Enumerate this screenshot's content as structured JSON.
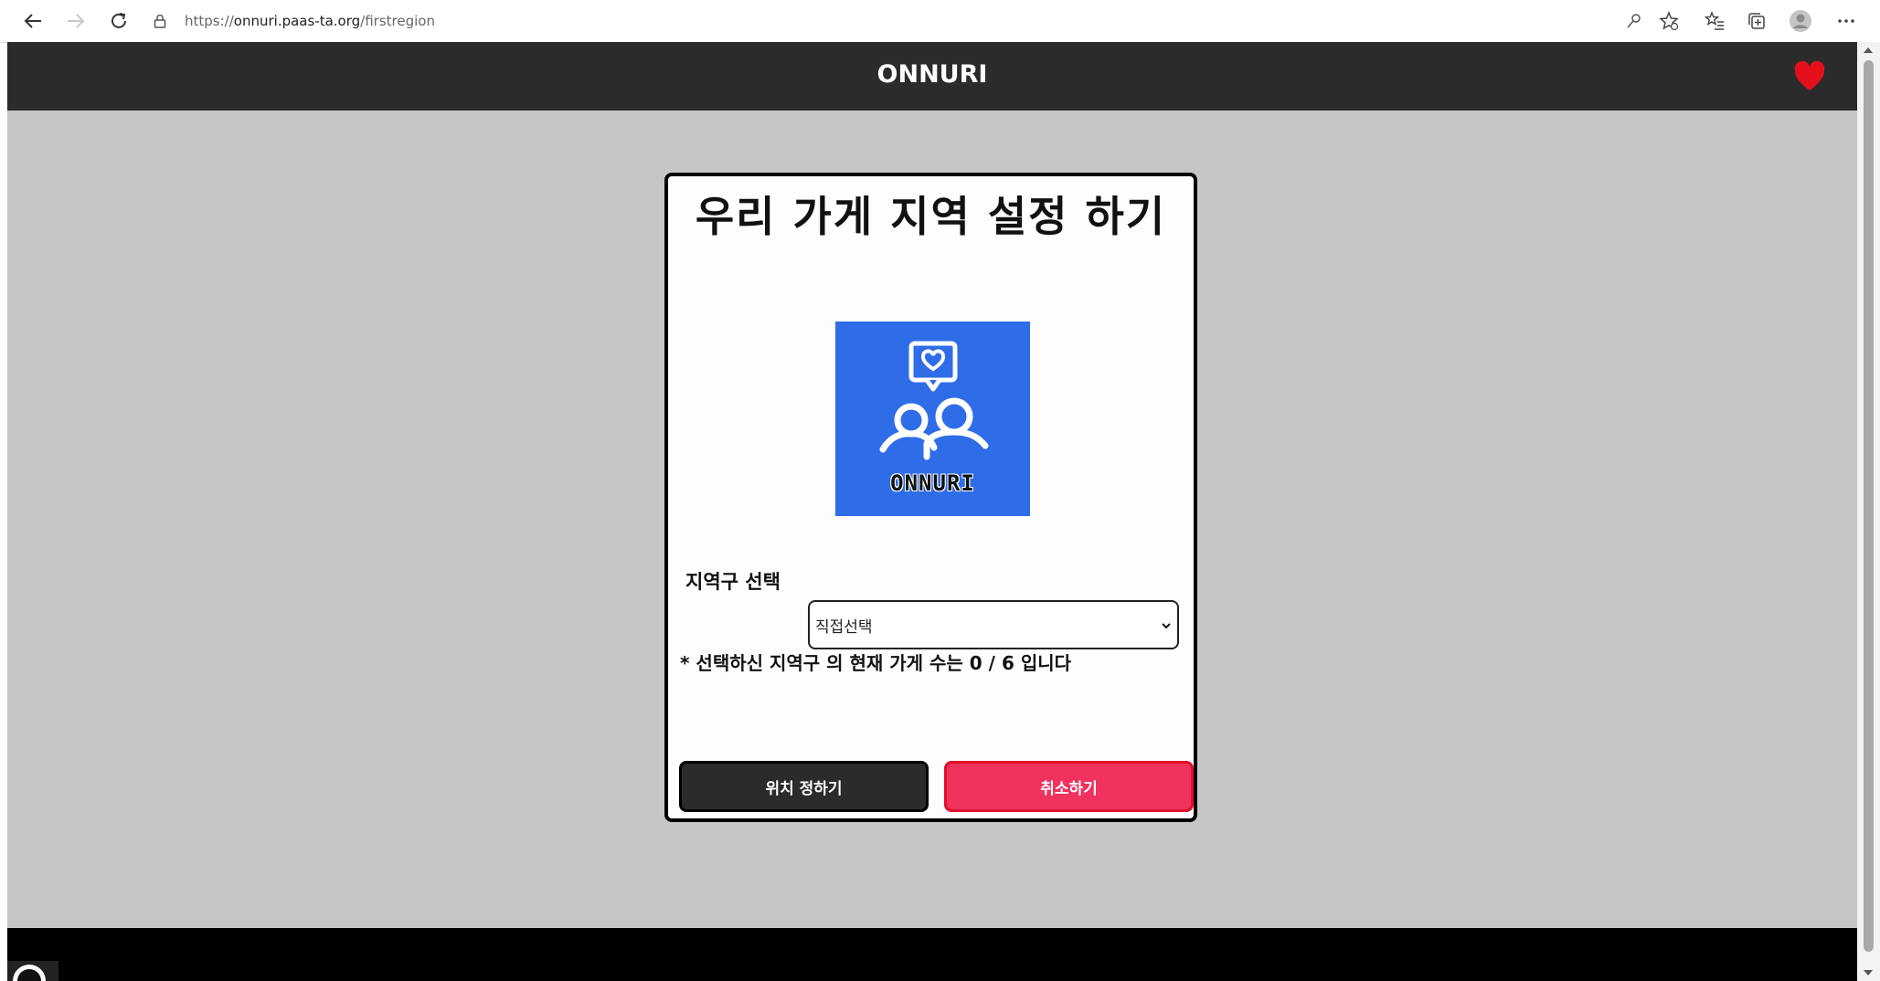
{
  "browser": {
    "url_scheme": "https://",
    "url_host": "onnuri.paas-ta.org",
    "url_path": "/firstregion"
  },
  "header": {
    "title": "ONNURI"
  },
  "modal": {
    "title": "우리 가게 지역 설정 하기",
    "logo_text": "ONNURI",
    "region_label": "지역구 선택",
    "region_select_value": "직접선택",
    "store_count_text": "* 선택하신 지역구 의 현재 가게 수는 0 / 6 입니다",
    "confirm_button": "위치 정하기",
    "cancel_button": "취소하기"
  },
  "colors": {
    "header_bg": "#2b2b2b",
    "page_bg": "#c6c6c6",
    "logo_bg": "#2f6de8",
    "heart": "#e3101b",
    "cancel_button": "#f1315e",
    "footer": "#000000"
  }
}
